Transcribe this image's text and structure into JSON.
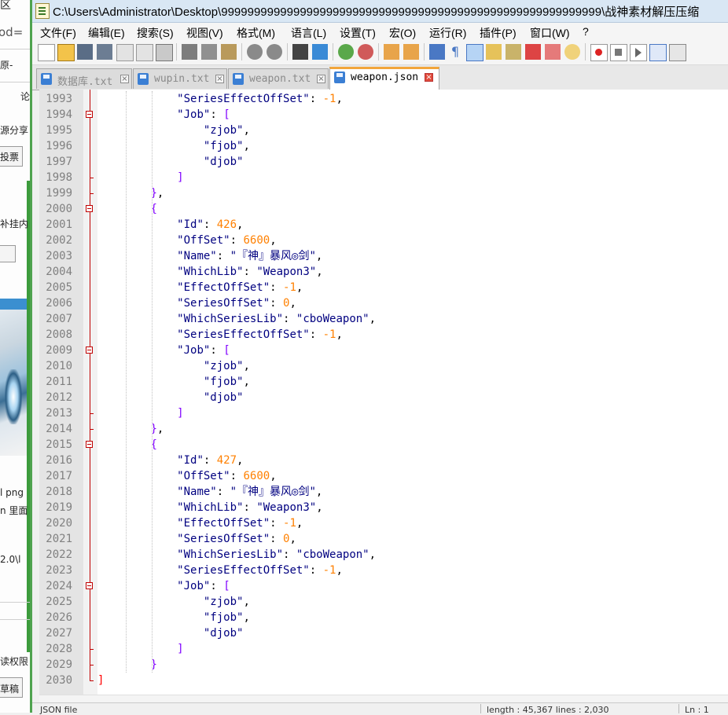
{
  "background_window": {
    "texts": [
      "区",
      "od=",
      "原-",
      "论",
      "源分享",
      "投票",
      "补挂内",
      "l png",
      "n 里面",
      "2.0\\l",
      "读权限",
      "草稿"
    ]
  },
  "window": {
    "title": "C:\\Users\\Administrator\\Desktop\\9999999999999999999999999999999999999999999999999999999999\\战神素材解压压缩"
  },
  "menu": [
    "文件(F)",
    "编辑(E)",
    "搜索(S)",
    "视图(V)",
    "格式(M)",
    "语言(L)",
    "设置(T)",
    "宏(O)",
    "运行(R)",
    "插件(P)",
    "窗口(W)",
    "?"
  ],
  "tabs": [
    {
      "label": "数据库.txt",
      "active": false
    },
    {
      "label": "wupin.txt",
      "active": false
    },
    {
      "label": "weapon.txt",
      "active": false
    },
    {
      "label": "weapon.json",
      "active": true
    }
  ],
  "editor": {
    "first_line": 1993,
    "lines": [
      "            \"SeriesEffectOffSet\": -1,",
      "            \"Job\": [",
      "                \"zjob\",",
      "                \"fjob\",",
      "                \"djob\"",
      "            ]",
      "        },",
      "        {",
      "            \"Id\": 426,",
      "            \"OffSet\": 6600,",
      "            \"Name\": \"『神』暴风◎剑\",",
      "            \"WhichLib\": \"Weapon3\",",
      "            \"EffectOffSet\": -1,",
      "            \"SeriesOffSet\": 0,",
      "            \"WhichSeriesLib\": \"cboWeapon\",",
      "            \"SeriesEffectOffSet\": -1,",
      "            \"Job\": [",
      "                \"zjob\",",
      "                \"fjob\",",
      "                \"djob\"",
      "            ]",
      "        },",
      "        {",
      "            \"Id\": 427,",
      "            \"OffSet\": 6600,",
      "            \"Name\": \"『神』暴风◎剑\",",
      "            \"WhichLib\": \"Weapon3\",",
      "            \"EffectOffSet\": -1,",
      "            \"SeriesOffSet\": 0,",
      "            \"WhichSeriesLib\": \"cboWeapon\",",
      "            \"SeriesEffectOffSet\": -1,",
      "            \"Job\": [",
      "                \"zjob\",",
      "                \"fjob\",",
      "                \"djob\"",
      "            ]",
      "        }",
      "]"
    ]
  },
  "statusbar": {
    "file_type": "JSON file",
    "position": "length : 45,367    lines : 2,030",
    "col": "Ln : 1"
  },
  "colors": {
    "keyword": "#000080",
    "number": "#ff8000",
    "bracket": "#8000ff",
    "fold_marker": "#c00000",
    "active_tab_accent": "#f2a53b"
  }
}
